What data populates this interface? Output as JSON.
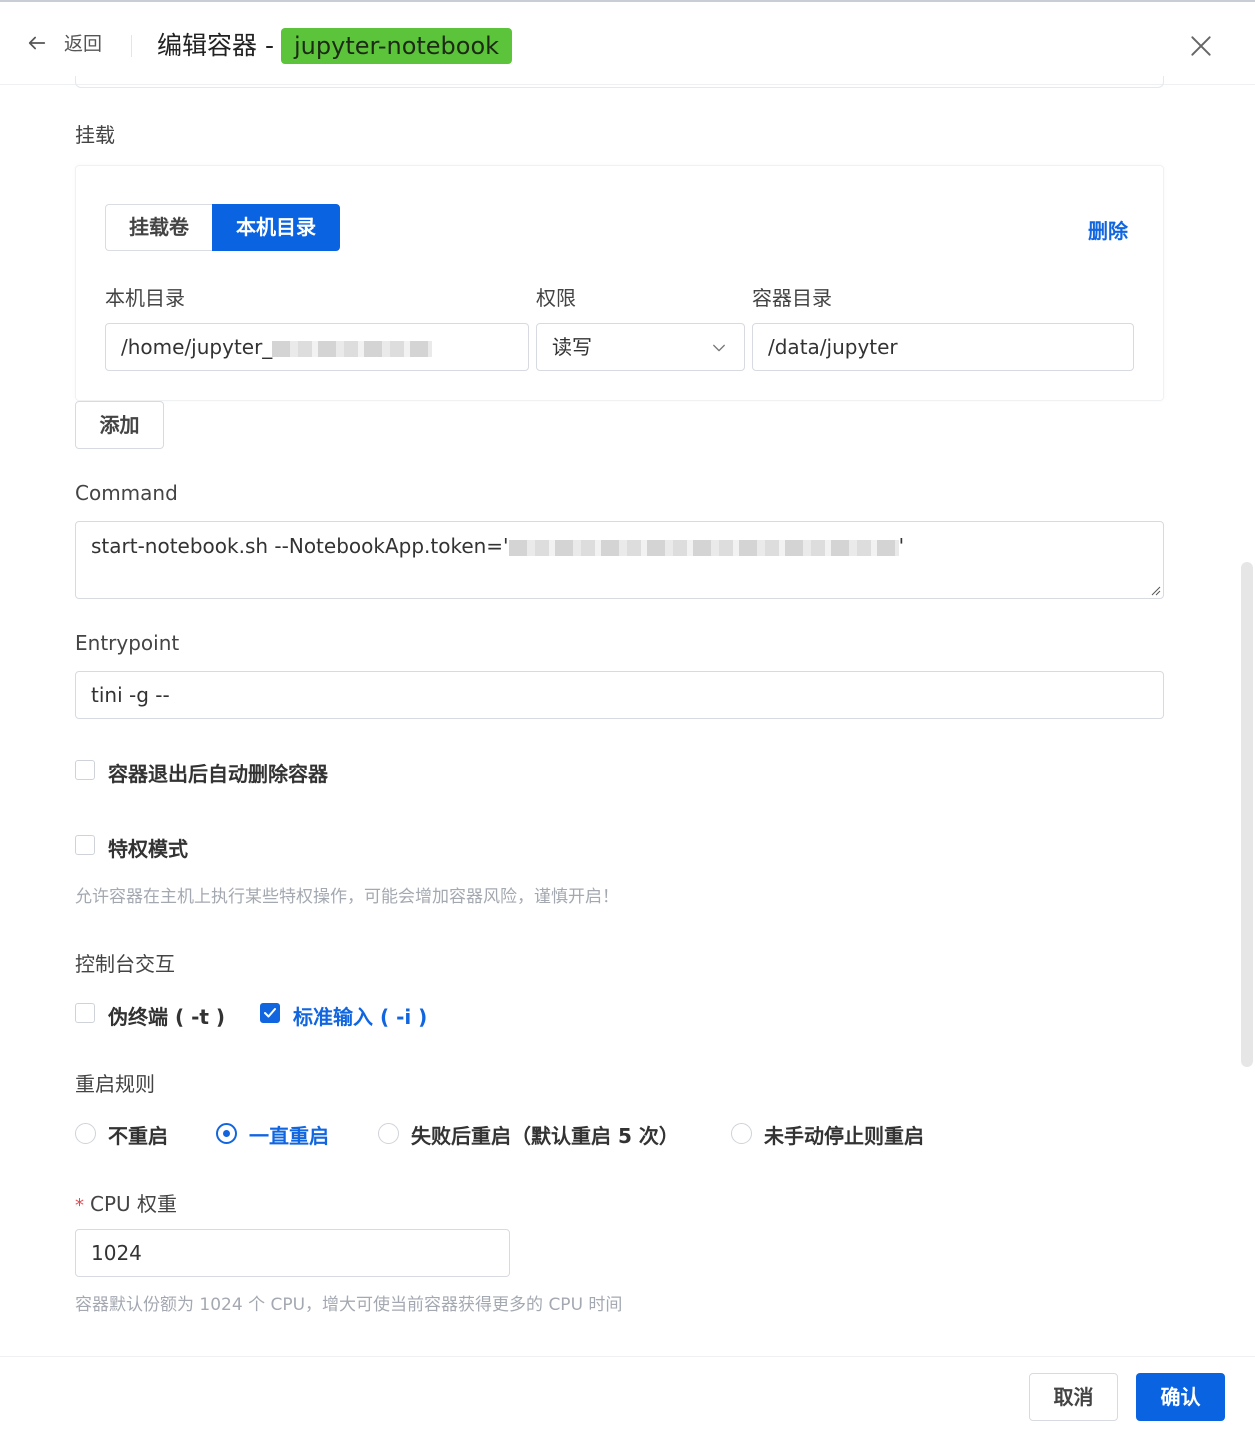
{
  "header": {
    "back_label": "返回",
    "title": "编辑容器 -",
    "container_name": "jupyter-notebook"
  },
  "mount": {
    "section_label": "挂载",
    "tabs": [
      "挂载卷",
      "本机目录"
    ],
    "active_tab": "本机目录",
    "delete_label": "删除",
    "columns": {
      "host_dir": "本机目录",
      "permission": "权限",
      "container_dir": "容器目录"
    },
    "row": {
      "host_dir_value": "/home/jupyter_",
      "permission_value": "读写",
      "container_dir_value": "/data/jupyter"
    },
    "add_label": "添加"
  },
  "command": {
    "label": "Command",
    "value": "start-notebook.sh --NotebookApp.token='",
    "value_end": "'"
  },
  "entrypoint": {
    "label": "Entrypoint",
    "value": "tini -g --"
  },
  "options": {
    "auto_remove_label": "容器退出后自动删除容器",
    "auto_remove_checked": false,
    "privileged_label": "特权模式",
    "privileged_checked": false,
    "privileged_hint": "允许容器在主机上执行某些特权操作，可能会增加容器风险，谨慎开启！"
  },
  "console": {
    "label": "控制台交互",
    "tty_label": "伪终端 ( -t )",
    "tty_checked": false,
    "stdin_label": "标准输入 ( -i )",
    "stdin_checked": true
  },
  "restart": {
    "label": "重启规则",
    "options": [
      "不重启",
      "一直重启",
      "失败后重启（默认重启 5 次）",
      "未手动停止则重启"
    ],
    "selected": "一直重启"
  },
  "cpu": {
    "required_mark": "*",
    "label": "CPU 权重",
    "value": "1024",
    "hint": "容器默认份额为 1024 个 CPU，增大可使当前容器获得更多的 CPU 时间"
  },
  "footer": {
    "cancel_label": "取消",
    "confirm_label": "确认"
  },
  "colors": {
    "primary": "#0a63e0",
    "tag_green": "#5cc43a"
  }
}
